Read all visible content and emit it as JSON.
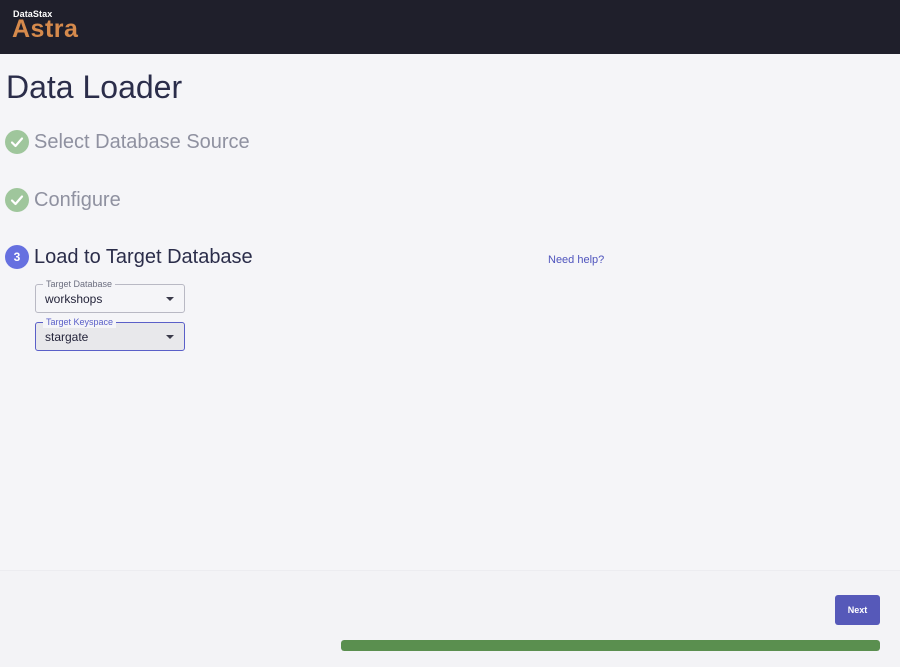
{
  "header": {
    "brand_small": "DataStax",
    "brand_big": "Astra"
  },
  "page": {
    "title": "Data Loader"
  },
  "steps": [
    {
      "label": "Select Database Source",
      "status": "complete",
      "icon": "check-icon"
    },
    {
      "label": "Configure",
      "status": "complete",
      "icon": "check-icon"
    },
    {
      "label": "Load to Target Database",
      "status": "active",
      "number": "3"
    }
  ],
  "help": {
    "label": "Need help?"
  },
  "form": {
    "target_database": {
      "label": "Target Database",
      "value": "workshops"
    },
    "target_keyspace": {
      "label": "Target Keyspace",
      "value": "stargate"
    }
  },
  "footer": {
    "next_label": "Next",
    "progress": 1.0
  },
  "colors": {
    "accent": "#5659b9",
    "step_active": "#6670e0",
    "step_complete": "#9fc69c",
    "progress": "#5a8f4f",
    "brand": "#d68a4c",
    "topbar": "#1f1f2b"
  }
}
